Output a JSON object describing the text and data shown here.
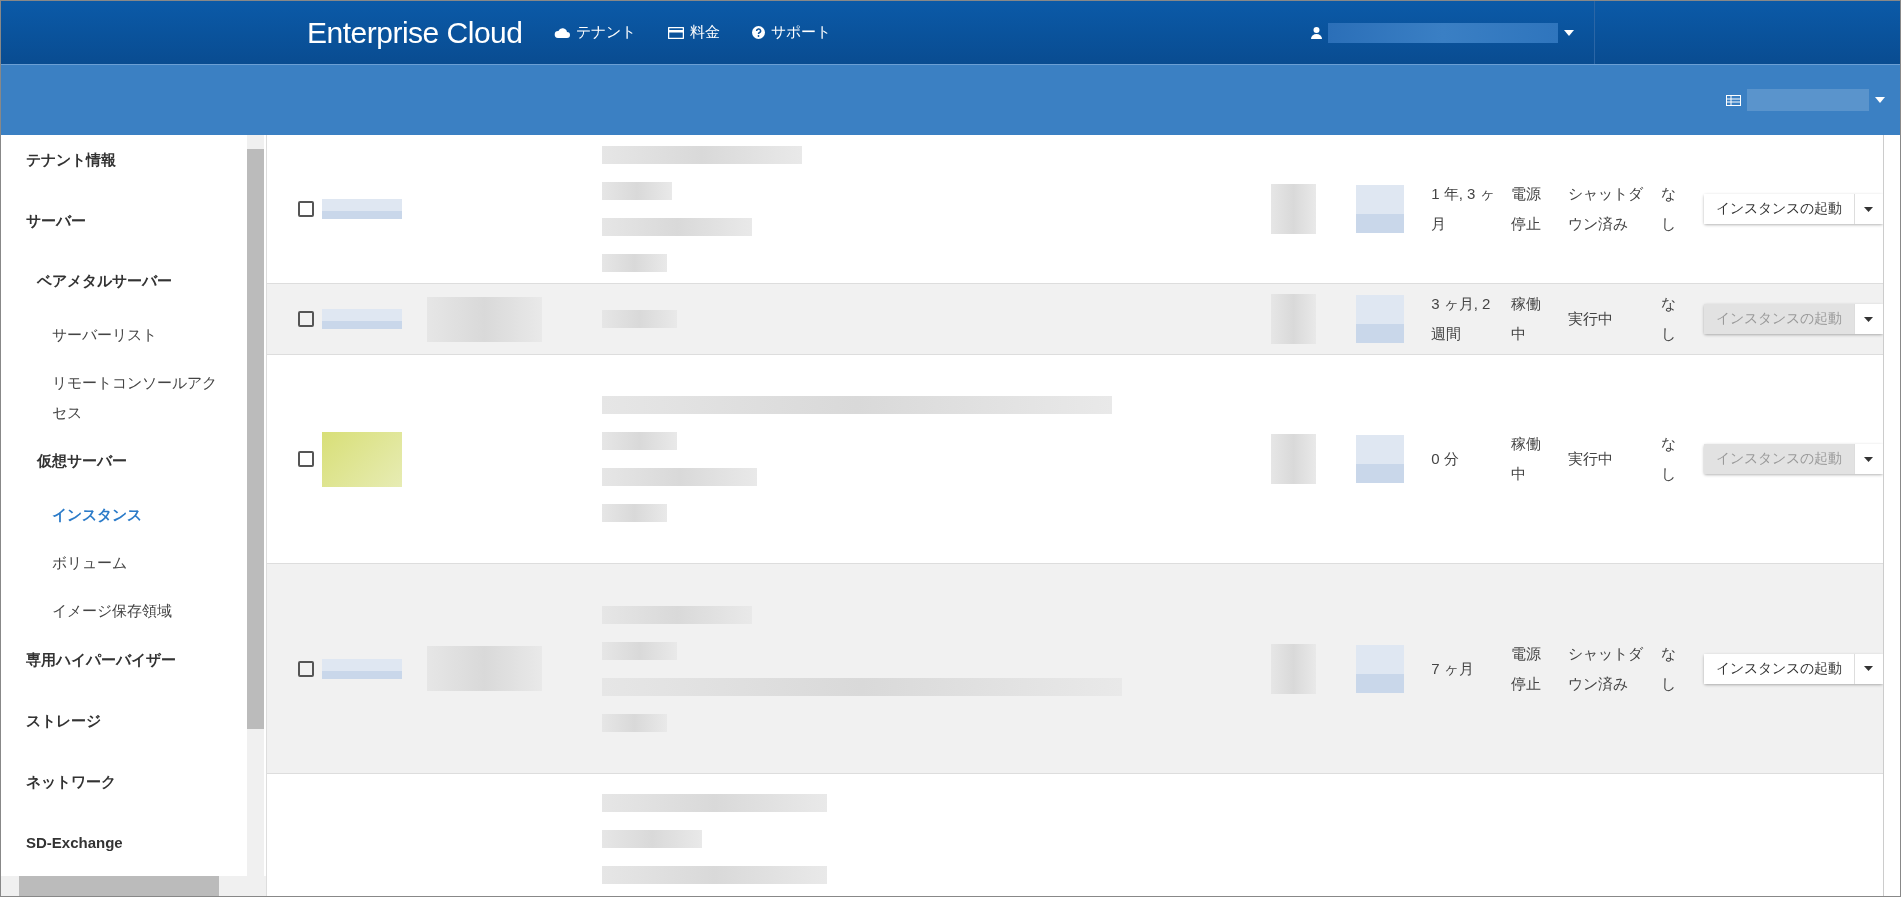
{
  "header": {
    "logo": "Enterprise Cloud",
    "nav": [
      {
        "label": "テナント"
      },
      {
        "label": "料金"
      },
      {
        "label": "サポート"
      }
    ]
  },
  "sidebar": {
    "items": [
      {
        "label": "テナント情報",
        "selected": false
      },
      {
        "label": "サーバー",
        "selected": false,
        "children": [
          {
            "label": "ベアメタルサーバー",
            "selected": false,
            "children": [
              {
                "label": "サーバーリスト",
                "selected": false
              },
              {
                "label": "リモートコンソールアクセス",
                "selected": false
              }
            ]
          },
          {
            "label": "仮想サーバー",
            "selected": false,
            "children": [
              {
                "label": "インスタンス",
                "selected": true
              },
              {
                "label": "ボリューム",
                "selected": false
              },
              {
                "label": "イメージ保存領域",
                "selected": false
              }
            ]
          }
        ]
      },
      {
        "label": "専用ハイパーバイザー",
        "selected": false
      },
      {
        "label": "ストレージ",
        "selected": false
      },
      {
        "label": "ネットワーク",
        "selected": false
      },
      {
        "label": "SD-Exchange",
        "selected": false
      }
    ]
  },
  "table": {
    "rows": [
      {
        "checked": false,
        "shaded": false,
        "age": "1 年, 3 ヶ月",
        "power": "電源停止",
        "status": "シャットダウン済み",
        "column_9": "なし",
        "action": {
          "label": "インスタンスの起動",
          "disabled": false
        }
      },
      {
        "checked": false,
        "shaded": true,
        "age": "3 ヶ月, 2 週間",
        "power": "稼働中",
        "status": "実行中",
        "column_9": "なし",
        "action": {
          "label": "インスタンスの起動",
          "disabled": true
        }
      },
      {
        "checked": false,
        "shaded": false,
        "age": "0 分",
        "power": "稼働中",
        "status": "実行中",
        "column_9": "なし",
        "action": {
          "label": "インスタンスの起動",
          "disabled": true
        }
      },
      {
        "checked": false,
        "shaded": true,
        "age": "7 ヶ月",
        "power": "電源停止",
        "status": "シャットダウン済み",
        "column_9": "なし",
        "action": {
          "label": "インスタンスの起動",
          "disabled": false
        }
      }
    ]
  }
}
